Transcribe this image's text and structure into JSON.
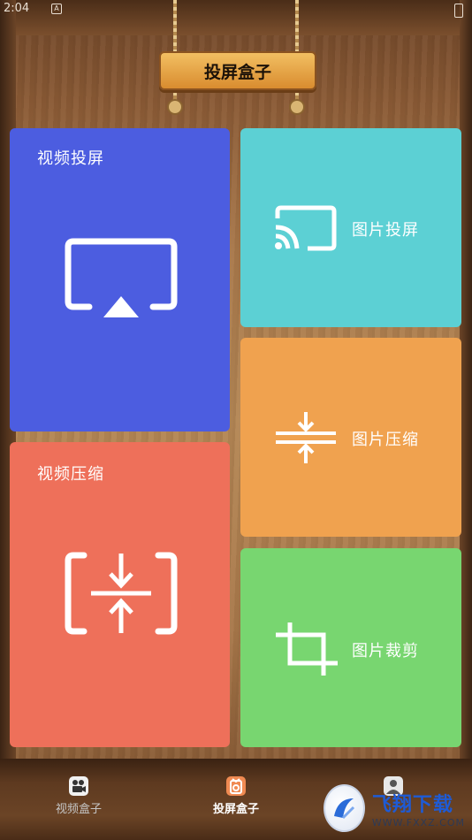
{
  "status_bar": {
    "time": "2:04",
    "notif": "A"
  },
  "header": {
    "title": "投屏盒子"
  },
  "tiles": {
    "video_cast": {
      "label": "视频投屏",
      "icon": "airplay-icon",
      "color": "#4c5de0"
    },
    "video_compress": {
      "label": "视频压缩",
      "icon": "compress-box-icon",
      "color": "#ee705a"
    },
    "image_cast": {
      "label": "图片投屏",
      "icon": "cast-icon",
      "color": "#5cd0d4"
    },
    "image_compress": {
      "label": "图片压缩",
      "icon": "compress-icon",
      "color": "#f0a24f"
    },
    "image_crop": {
      "label": "图片裁剪",
      "icon": "crop-icon",
      "color": "#78d670"
    }
  },
  "bottom_nav": {
    "items": [
      {
        "label": "视频盒子",
        "icon": "video-box-icon",
        "active": false
      },
      {
        "label": "投屏盒子",
        "icon": "cast-box-icon",
        "active": true
      },
      {
        "label": "",
        "icon": "profile-icon",
        "active": false
      }
    ]
  },
  "watermark": {
    "main": "飞翔下载",
    "sub": "WWW.FXXZ.COM"
  }
}
